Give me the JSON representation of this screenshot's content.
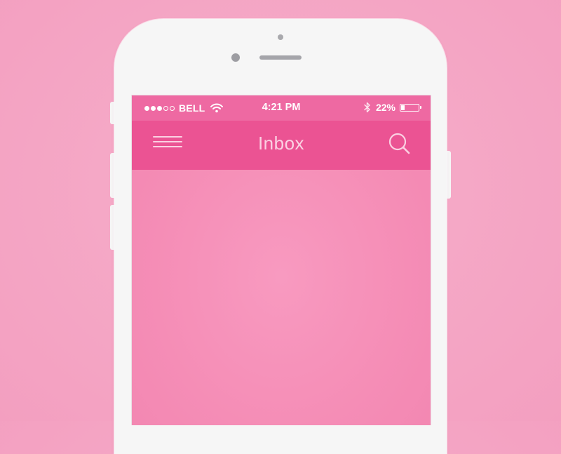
{
  "status_bar": {
    "signal_bars_filled": 3,
    "signal_bars_total": 5,
    "carrier": "BELL",
    "time": "4:21 PM",
    "battery_percent_text": "22%",
    "battery_level": 0.22,
    "icons": [
      "signal-dots",
      "wifi-icon",
      "bluetooth-icon",
      "battery-icon"
    ]
  },
  "nav": {
    "title": "Inbox",
    "left_icon": "hamburger-menu-icon",
    "right_icon": "search-icon"
  },
  "colors": {
    "background": "#f5a8c6",
    "status_bar": "#ee69a2",
    "nav_bar": "#eb5393",
    "screen_body": "#f58db6",
    "nav_text": "#fbd0e2",
    "phone_body": "#f6f6f6"
  }
}
